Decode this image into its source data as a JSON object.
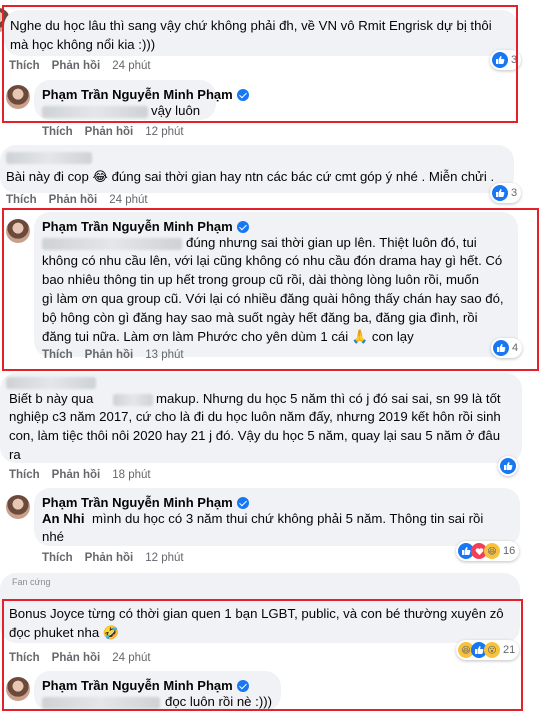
{
  "actions": {
    "like": "Thích",
    "reply": "Phản hồi"
  },
  "comments": [
    {
      "text": "Nghe du học lâu thì sang vậy chứ không phải đh, về VN vô Rmit Engrisk dự bị thôi mà học không nổi kia :)))",
      "time": "24 phút",
      "reactions": "3"
    },
    {
      "author": "Phạm Trần Nguyễn Minh Phạm",
      "text_suffix": "vậy luôn",
      "time": "12 phút"
    },
    {
      "text": "Bài này đi cop 😂 đúng sai thời gian hay ntn các bác cứ cmt góp ý nhé . Miễn chửi .",
      "time": "24 phút",
      "reactions": "3"
    },
    {
      "author": "Phạm Trần Nguyễn Minh Phạm",
      "line1_suffix": "đúng nhưng sai thời gian up lên. Thiệt luôn đó, tui",
      "rest": "không có nhu cầu lên, với lại cũng không có nhu cầu đón drama hay gì hết. Có\nbao nhiêu thông tin up hết trong group cũ rồi, dài thòng lòng luôn rồi, muốn\ngì làm ơn qua group cũ. Với lại có nhiều đăng quài hông thấy chán hay sao đó,\nbộ hông còn gì đăng hay sao mà suốt ngày hết đăng ba, đăng gia đình, rồi\nđăng tui nữa. Làm ơn làm Phước cho yên dùm 1 cái 🙏 con lạy",
      "time": "13 phút",
      "reactions": "4"
    },
    {
      "line1_prefix": "Biết b này qua",
      "line1_suffix": "makup. Nhưng du học 5 năm thì có j đó sai sai, sn 99 là tốt",
      "rest": "nghiệp c3 năm 2017, cứ cho là đi du học luôn năm đấy, nhưng 2019 kết hôn rồi sinh\ncon, làm tiệc thôi nôi 2020 hay 21 j đó. Vậy du học 5 năm, quay lại sau 5 năm ở đâu\nra",
      "time": "18 phút"
    },
    {
      "author": "Phạm Trần Nguyễn Minh Phạm",
      "mention": "An Nhi",
      "line1_suffix": "mình du học có 3 năm thui chứ không phải 5 năm. Thông tin sai rồi",
      "rest": "nhé",
      "time": "12 phút",
      "reactions": "16"
    },
    {
      "badge": "Fan cứng",
      "text": "Bonus Joyce từng có thời gian quen 1 bạn LGBT, public, và con bé thường xuyên zô\nđọc phuket nha 🤣",
      "time": "24 phút",
      "reactions": "21"
    },
    {
      "author": "Phạm Trần Nguyễn Minh Phạm",
      "text_suffix": "đọc luôn rồi nè :)))"
    }
  ],
  "colors": {
    "highlight": "#e4202a",
    "bubble": "#f0f2f5",
    "like": "#1877f2",
    "meta": "#65676b"
  }
}
